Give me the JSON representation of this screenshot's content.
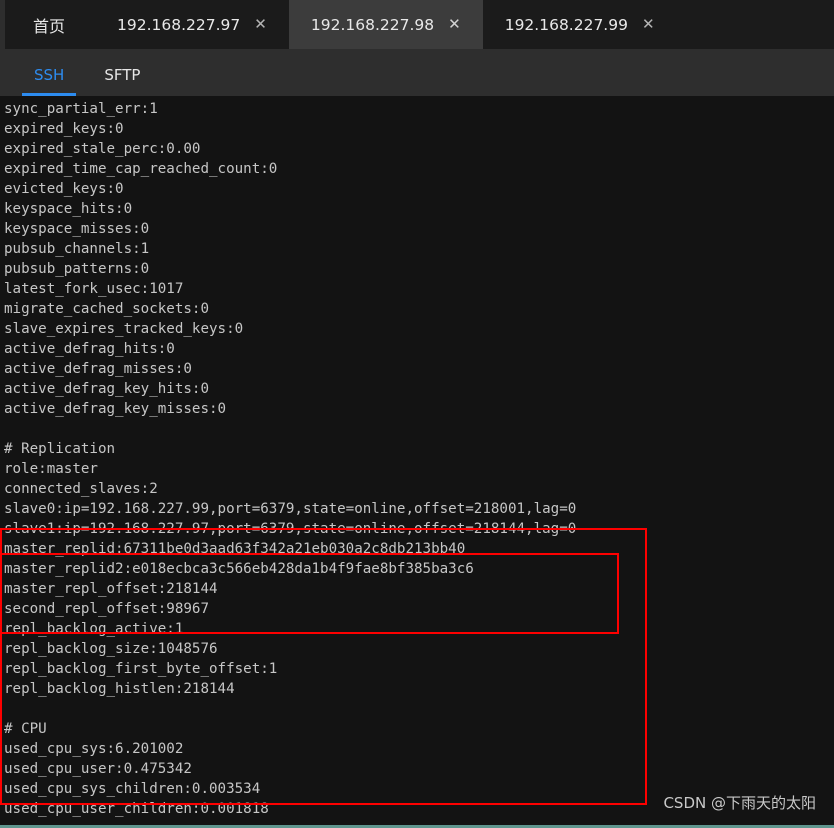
{
  "window": {
    "background_color": "#131313",
    "bottom_border_color": "#5f968e"
  },
  "tabbar": {
    "background_color": "#1b1b1b",
    "active_background_color": "#3c3c3c",
    "close_glyph": "✕",
    "tabs": [
      {
        "label": "首页",
        "active": false,
        "closable": false
      },
      {
        "label": "192.168.227.97",
        "active": false,
        "closable": true
      },
      {
        "label": "192.168.227.98",
        "active": true,
        "closable": true
      },
      {
        "label": "192.168.227.99",
        "active": false,
        "closable": true
      }
    ]
  },
  "subtabs": {
    "accent_color": "#2d8cf0",
    "items": [
      {
        "label": "SSH",
        "active": true
      },
      {
        "label": "SFTP",
        "active": false
      }
    ]
  },
  "terminal": {
    "text_color": "#c6c6c6",
    "lines": [
      "sync_partial_err:1",
      "expired_keys:0",
      "expired_stale_perc:0.00",
      "expired_time_cap_reached_count:0",
      "evicted_keys:0",
      "keyspace_hits:0",
      "keyspace_misses:0",
      "pubsub_channels:1",
      "pubsub_patterns:0",
      "latest_fork_usec:1017",
      "migrate_cached_sockets:0",
      "slave_expires_tracked_keys:0",
      "active_defrag_hits:0",
      "active_defrag_misses:0",
      "active_defrag_key_hits:0",
      "active_defrag_key_misses:0",
      "",
      "# Replication",
      "role:master",
      "connected_slaves:2",
      "slave0:ip=192.168.227.99,port=6379,state=online,offset=218001,lag=0",
      "slave1:ip=192.168.227.97,port=6379,state=online,offset=218144,lag=0",
      "master_replid:67311be0d3aad63f342a21eb030a2c8db213bb40",
      "master_replid2:e018ecbca3c566eb428da1b4f9fae8bf385ba3c6",
      "master_repl_offset:218144",
      "second_repl_offset:98967",
      "repl_backlog_active:1",
      "repl_backlog_size:1048576",
      "repl_backlog_first_byte_offset:1",
      "repl_backlog_histlen:218144",
      "",
      "# CPU",
      "used_cpu_sys:6.201002",
      "used_cpu_user:0.475342",
      "used_cpu_sys_children:0.003534",
      "used_cpu_user_children:0.001818"
    ]
  },
  "annotations": {
    "highlight_color": "#fe0000",
    "boxes": [
      {
        "name": "replication-section-box"
      },
      {
        "name": "connected-slaves-box"
      }
    ]
  },
  "watermark": {
    "text": "CSDN @下雨天的太阳"
  }
}
